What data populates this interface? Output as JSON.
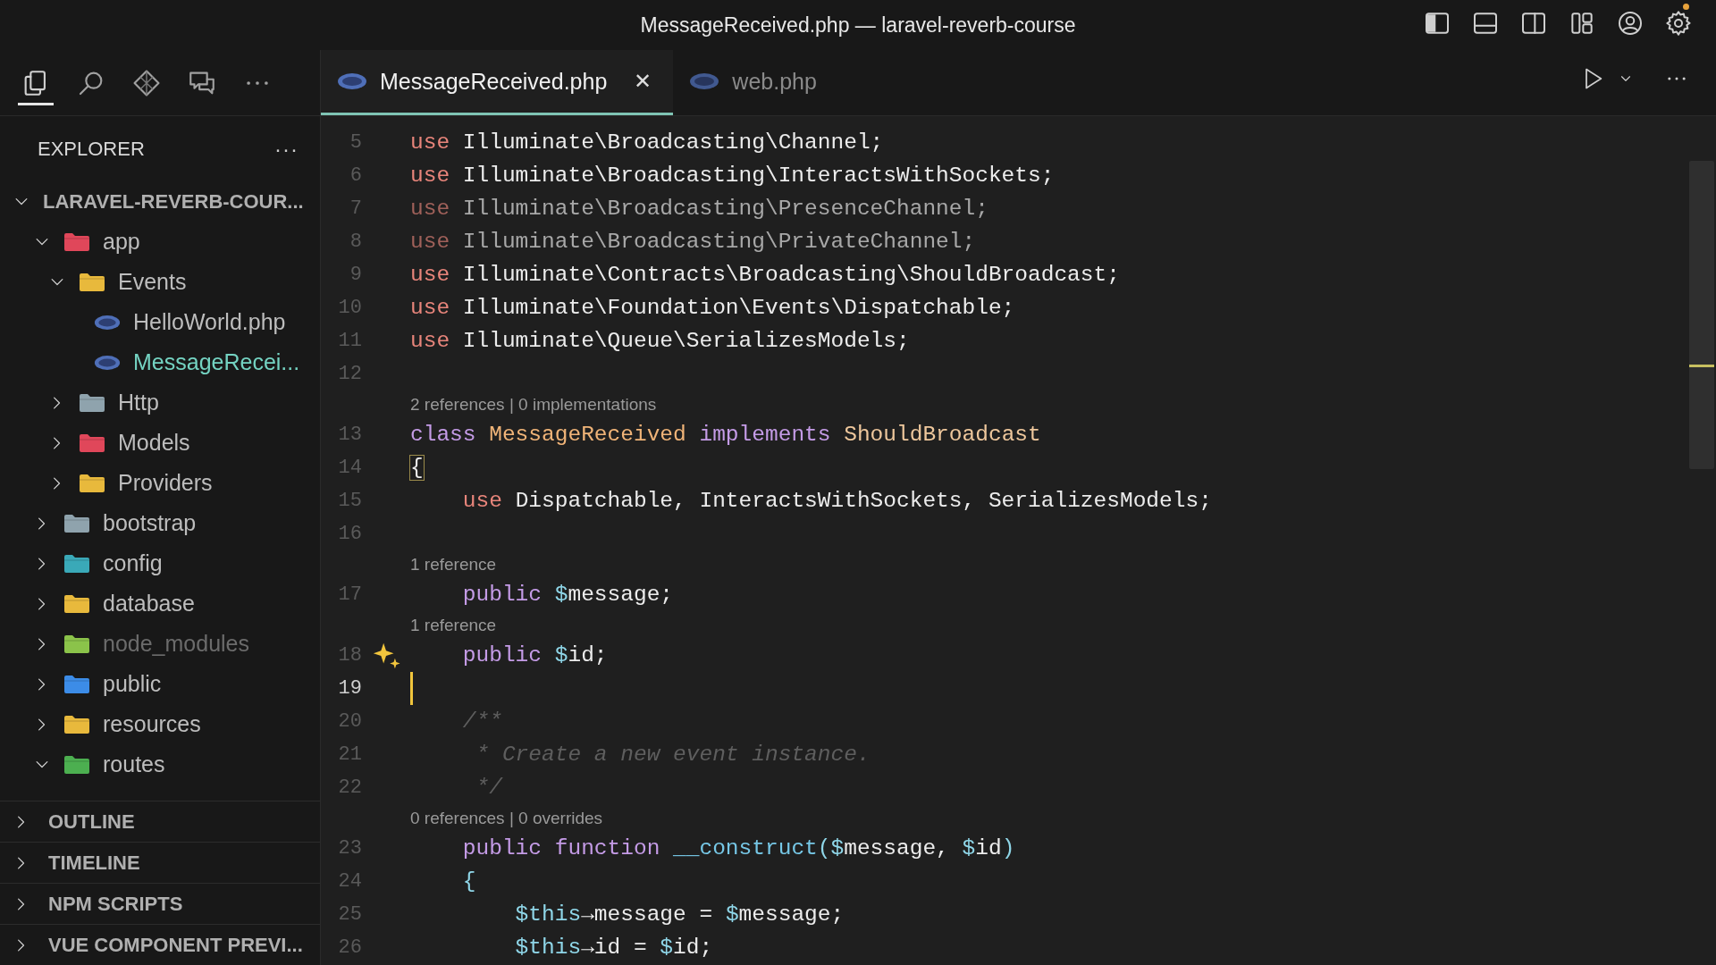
{
  "window": {
    "title": "MessageReceived.php — laravel-reverb-course",
    "layout_toggles": [
      {
        "on": true
      },
      {
        "on": false
      },
      {
        "on": false
      }
    ],
    "settings_notification": true
  },
  "activity_bar": [
    {
      "selected": true
    },
    {
      "selected": false
    },
    {
      "selected": false
    },
    {
      "selected": false
    },
    {
      "selected": false
    }
  ],
  "sidebar": {
    "title": "EXPLORER",
    "more": "···",
    "tree": {
      "label": "LARAVEL-REVERB-COUR...",
      "expanded": true,
      "children": [
        {
          "label": "app",
          "kind": "folder",
          "color": "#e0475a",
          "expanded": true,
          "selected": false,
          "ignored": false,
          "children": [
            {
              "label": "Events",
              "kind": "folder",
              "color": "#e8b93c",
              "expanded": true,
              "selected": false,
              "ignored": false,
              "children": [
                {
                  "label": "HelloWorld.php",
                  "kind": "file",
                  "selected": false,
                  "ignored": false
                },
                {
                  "label": "MessageRecei...",
                  "kind": "file",
                  "selected": true,
                  "ignored": false
                }
              ]
            },
            {
              "label": "Http",
              "kind": "folder",
              "color": "#8fa3ad",
              "expanded": false,
              "selected": false,
              "ignored": false
            },
            {
              "label": "Models",
              "kind": "folder",
              "color": "#e0475a",
              "expanded": false,
              "selected": false,
              "ignored": false
            },
            {
              "label": "Providers",
              "kind": "folder",
              "color": "#e8b93c",
              "expanded": false,
              "selected": false,
              "ignored": false
            }
          ]
        },
        {
          "label": "bootstrap",
          "kind": "folder",
          "color": "#8fa3ad",
          "expanded": false,
          "selected": false,
          "ignored": false
        },
        {
          "label": "config",
          "kind": "folder",
          "color": "#3aa9b8",
          "expanded": false,
          "selected": false,
          "ignored": false
        },
        {
          "label": "database",
          "kind": "folder",
          "color": "#e8b93c",
          "expanded": false,
          "selected": false,
          "ignored": false
        },
        {
          "label": "node_modules",
          "kind": "folder",
          "color": "#8bc34a",
          "expanded": false,
          "selected": false,
          "ignored": true
        },
        {
          "label": "public",
          "kind": "folder",
          "color": "#3c8ce7",
          "expanded": false,
          "selected": false,
          "ignored": false
        },
        {
          "label": "resources",
          "kind": "folder",
          "color": "#e8b93c",
          "expanded": false,
          "selected": false,
          "ignored": false
        },
        {
          "label": "routes",
          "kind": "folder",
          "color": "#4caf50",
          "expanded": true,
          "selected": false,
          "ignored": false
        }
      ]
    },
    "sections": [
      {
        "label": "OUTLINE",
        "expanded": false
      },
      {
        "label": "TIMELINE",
        "expanded": false
      },
      {
        "label": "NPM SCRIPTS",
        "expanded": false
      },
      {
        "label": "VUE COMPONENT PREVI...",
        "expanded": false
      }
    ]
  },
  "tabs": [
    {
      "label": "MessageReceived.php",
      "selected": true,
      "close": "✕"
    },
    {
      "label": "web.php",
      "selected": false
    }
  ],
  "editor": {
    "lines": [
      {
        "kind": "code",
        "number": "5",
        "current": false,
        "unused": false,
        "tokens": [
          {
            "kind": "keyword",
            "text": "use "
          },
          {
            "kind": "name",
            "text": "Illuminate\\Broadcasting\\Channel;"
          }
        ]
      },
      {
        "kind": "code",
        "number": "6",
        "current": false,
        "unused": false,
        "tokens": [
          {
            "kind": "keyword",
            "text": "use "
          },
          {
            "kind": "name",
            "text": "Illuminate\\Broadcasting\\InteractsWithSockets;"
          }
        ]
      },
      {
        "kind": "code",
        "number": "7",
        "current": false,
        "unused": true,
        "tokens": [
          {
            "kind": "keyword",
            "text": "use "
          },
          {
            "kind": "name",
            "text": "Illuminate\\Broadcasting\\PresenceChannel;"
          }
        ]
      },
      {
        "kind": "code",
        "number": "8",
        "current": false,
        "unused": true,
        "tokens": [
          {
            "kind": "keyword",
            "text": "use "
          },
          {
            "kind": "name",
            "text": "Illuminate\\Broadcasting\\PrivateChannel;"
          }
        ]
      },
      {
        "kind": "code",
        "number": "9",
        "current": false,
        "unused": false,
        "tokens": [
          {
            "kind": "keyword",
            "text": "use "
          },
          {
            "kind": "name",
            "text": "Illuminate\\Contracts\\Broadcasting\\ShouldBroadcast;"
          }
        ]
      },
      {
        "kind": "code",
        "number": "10",
        "current": false,
        "unused": false,
        "tokens": [
          {
            "kind": "keyword",
            "text": "use "
          },
          {
            "kind": "name",
            "text": "Illuminate\\Foundation\\Events\\Dispatchable;"
          }
        ]
      },
      {
        "kind": "code",
        "number": "11",
        "current": false,
        "unused": false,
        "tokens": [
          {
            "kind": "keyword",
            "text": "use "
          },
          {
            "kind": "name",
            "text": "Illuminate\\Queue\\SerializesModels;"
          }
        ]
      },
      {
        "kind": "code",
        "number": "12",
        "current": false
      },
      {
        "kind": "lens",
        "text": "2 references | 0 implementations"
      },
      {
        "kind": "code",
        "number": "13",
        "current": false,
        "unused": false,
        "tokens": [
          {
            "kind": "storage",
            "text": "class "
          },
          {
            "kind": "type",
            "text": "MessageReceived "
          },
          {
            "kind": "storage",
            "text": "implements "
          },
          {
            "kind": "type2",
            "text": "ShouldBroadcast"
          }
        ]
      },
      {
        "kind": "code",
        "number": "14",
        "current": false,
        "unused": false,
        "tokens": [
          {
            "kind": "match",
            "text": "{"
          }
        ]
      },
      {
        "kind": "code",
        "number": "15",
        "current": false,
        "unused": false,
        "tokens": [
          {
            "kind": "keyword",
            "text": "    use "
          },
          {
            "kind": "name",
            "text": "Dispatchable, InteractsWithSockets, SerializesModels;"
          }
        ]
      },
      {
        "kind": "code",
        "number": "16",
        "current": false
      },
      {
        "kind": "lens",
        "text": "1 reference"
      },
      {
        "kind": "code",
        "number": "17",
        "current": false,
        "unused": false,
        "tokens": [
          {
            "kind": "storage",
            "text": "    public "
          },
          {
            "kind": "sigil",
            "text": "$"
          },
          {
            "kind": "name",
            "text": "message;"
          }
        ]
      },
      {
        "kind": "lens",
        "text": "1 reference"
      },
      {
        "kind": "code",
        "number": "18",
        "current": false,
        "unused": false,
        "sparkle": true,
        "tokens": [
          {
            "kind": "storage",
            "text": "    public "
          },
          {
            "kind": "sigil",
            "text": "$"
          },
          {
            "kind": "name",
            "text": "id;"
          }
        ]
      },
      {
        "kind": "code",
        "number": "19",
        "current": true
      },
      {
        "kind": "code",
        "number": "20",
        "current": false,
        "unused": false,
        "tokens": [
          {
            "kind": "comment",
            "text": "    /**"
          }
        ]
      },
      {
        "kind": "code",
        "number": "21",
        "current": false,
        "unused": false,
        "tokens": [
          {
            "kind": "comment",
            "text": "     * Create a new event instance."
          }
        ]
      },
      {
        "kind": "code",
        "number": "22",
        "current": false,
        "unused": false,
        "tokens": [
          {
            "kind": "comment",
            "text": "     */"
          }
        ]
      },
      {
        "kind": "lens",
        "text": "0 references | 0 overrides"
      },
      {
        "kind": "code",
        "number": "23",
        "current": false,
        "unused": false,
        "tokens": [
          {
            "kind": "storage",
            "text": "    public function "
          },
          {
            "kind": "function",
            "text": "__construct"
          },
          {
            "kind": "sigil",
            "text": "($"
          },
          {
            "kind": "name",
            "text": "message, "
          },
          {
            "kind": "sigil",
            "text": "$"
          },
          {
            "kind": "name",
            "text": "id"
          },
          {
            "kind": "sigil",
            "text": ")"
          }
        ]
      },
      {
        "kind": "code",
        "number": "24",
        "current": false,
        "unused": false,
        "tokens": [
          {
            "kind": "sigil",
            "text": "    {"
          }
        ]
      },
      {
        "kind": "code",
        "number": "25",
        "current": false,
        "unused": false,
        "tokens": [
          {
            "kind": "sigil",
            "text": "        $this"
          },
          {
            "kind": "name",
            "text": "→message = "
          },
          {
            "kind": "sigil",
            "text": "$"
          },
          {
            "kind": "name",
            "text": "message;"
          }
        ]
      },
      {
        "kind": "code",
        "number": "26",
        "current": false,
        "unused": false,
        "tokens": [
          {
            "kind": "sigil",
            "text": "        $this"
          },
          {
            "kind": "name",
            "text": "→id = "
          },
          {
            "kind": "sigil",
            "text": "$"
          },
          {
            "kind": "name",
            "text": "id;"
          }
        ]
      }
    ]
  }
}
